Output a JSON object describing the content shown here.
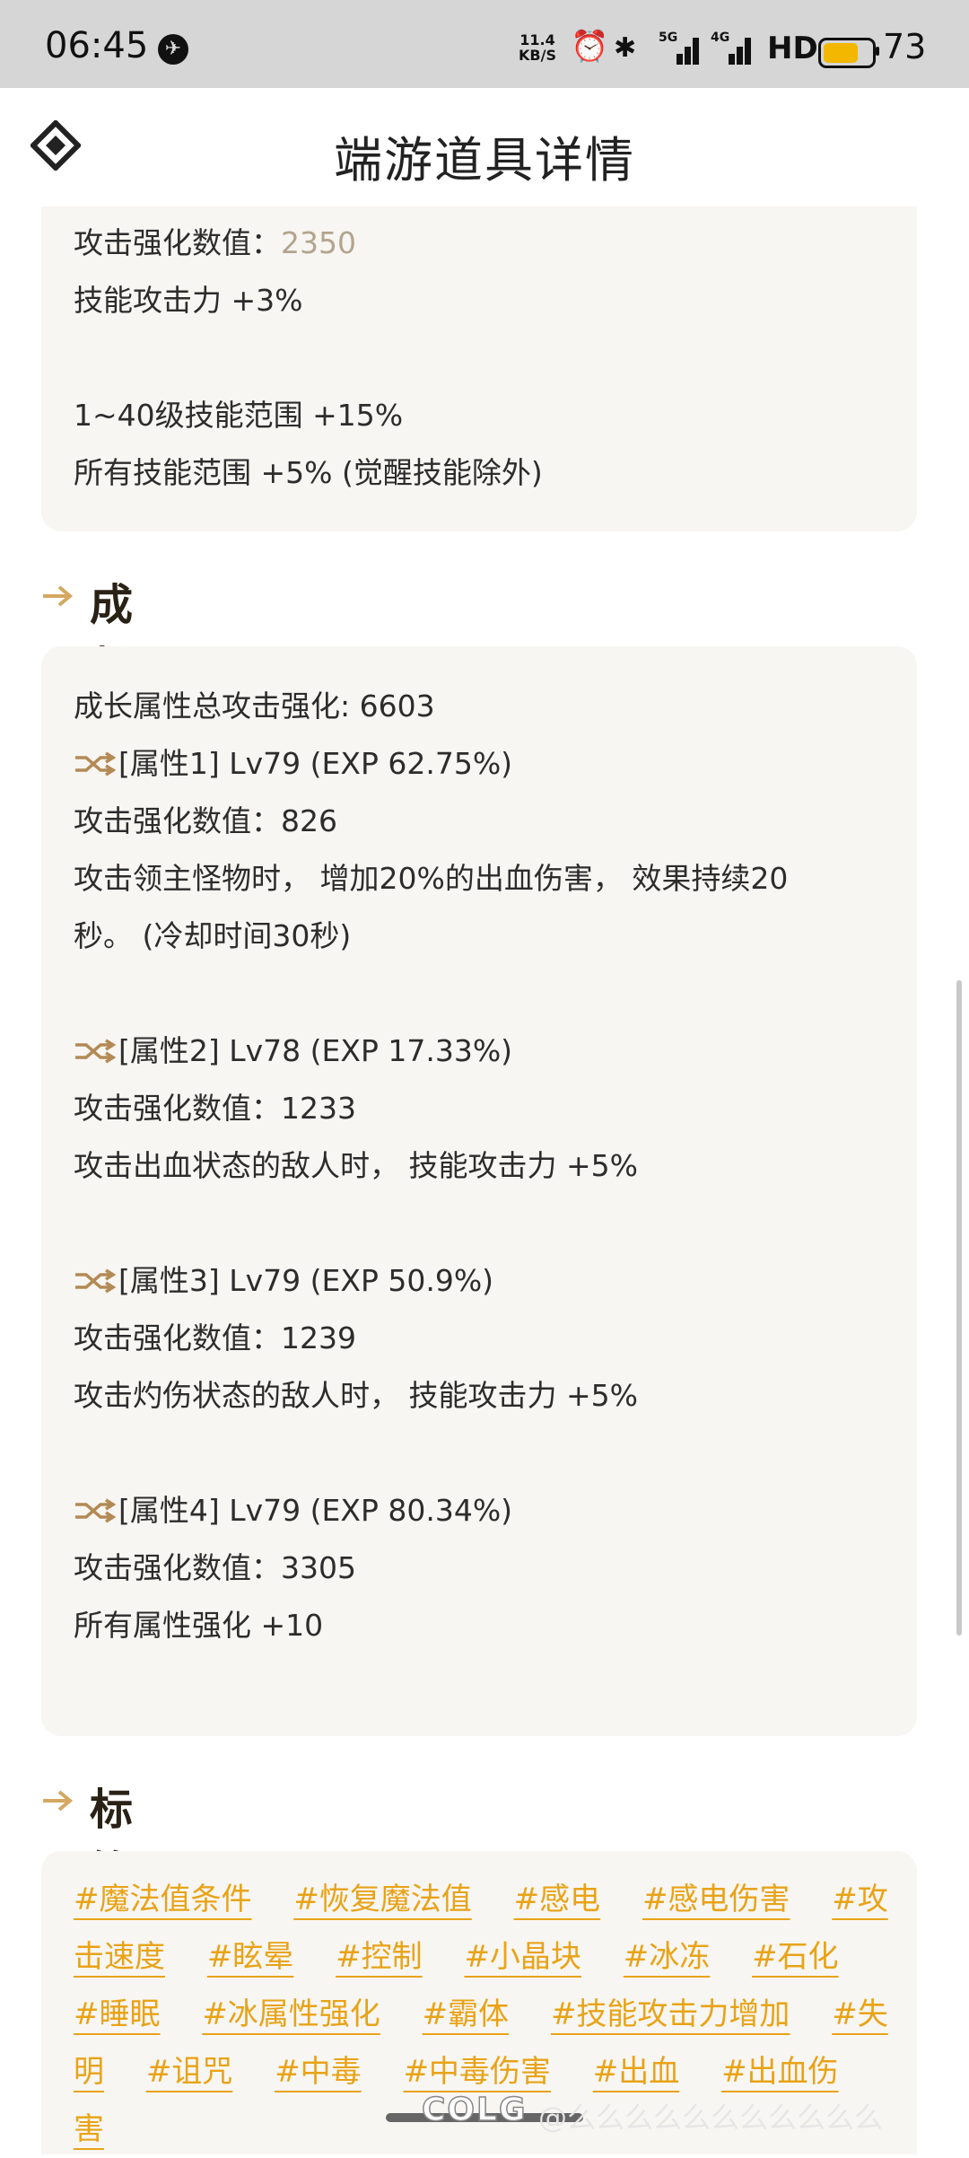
{
  "status_bar": {
    "time": "06:45",
    "net_speed_value": "11.4",
    "net_speed_unit": "KB/S",
    "hd": "HD",
    "battery": "73",
    "battery_level": 0.73,
    "icons": [
      "globe-icon",
      "alarm-icon",
      "bluetooth-icon",
      "signal-5g-icon",
      "signal-4g-icon",
      "battery-icon"
    ]
  },
  "header": {
    "title": "端游道具详情",
    "logo_icon": "diamond-logo-icon"
  },
  "card1": {
    "lines": [
      {
        "label": "攻击强化数值：",
        "value": "2350"
      },
      {
        "text": "技能攻击力 +3%"
      },
      {
        "text": "1~40级技能范围 +15%"
      },
      {
        "text": "所有技能范围 +5% (觉醒技能除外)"
      }
    ]
  },
  "growth": {
    "title": "成长属性",
    "total": "成长属性总攻击强化: 6603",
    "attrs": [
      {
        "head": "[属性1] Lv79 (EXP 62.75%)",
        "value": "攻击强化数值：826",
        "desc": "攻击领主怪物时， 增加20%的出血伤害， 效果持续20",
        "desc2": "秒。 (冷却时间30秒)"
      },
      {
        "head": "[属性2] Lv78 (EXP 17.33%)",
        "value": "攻击强化数值：1233",
        "desc": "攻击出血状态的敌人时， 技能攻击力 +5%"
      },
      {
        "head": "[属性3] Lv79 (EXP 50.9%)",
        "value": "攻击强化数值：1239",
        "desc": "攻击灼伤状态的敌人时， 技能攻击力 +5%"
      },
      {
        "head": "[属性4] Lv79 (EXP 80.34%)",
        "value": "攻击强化数值：3305",
        "desc": "所有属性强化 +10"
      }
    ]
  },
  "tags": {
    "title": "标签",
    "items": [
      "#魔法值条件",
      "#恢复魔法值",
      "#感电",
      "#感电伤害",
      "#攻击速度",
      "#眩晕",
      "#控制",
      "#小晶块",
      "#冰冻",
      "#石化",
      "#睡眠",
      "#冰属性强化",
      "#霸体",
      "#技能攻击力增加",
      "#失明",
      "#诅咒",
      "#中毒",
      "#中毒伤害",
      "#出血",
      "#出血伤害"
    ]
  },
  "watermark": {
    "text": "COLG",
    "suffix": "@么么么么么么么么么么么"
  },
  "colors": {
    "accent": "#e8a317",
    "card_bg": "#f8f6f3",
    "heading": "#2a2116",
    "muted_value": "#b3a48c"
  }
}
